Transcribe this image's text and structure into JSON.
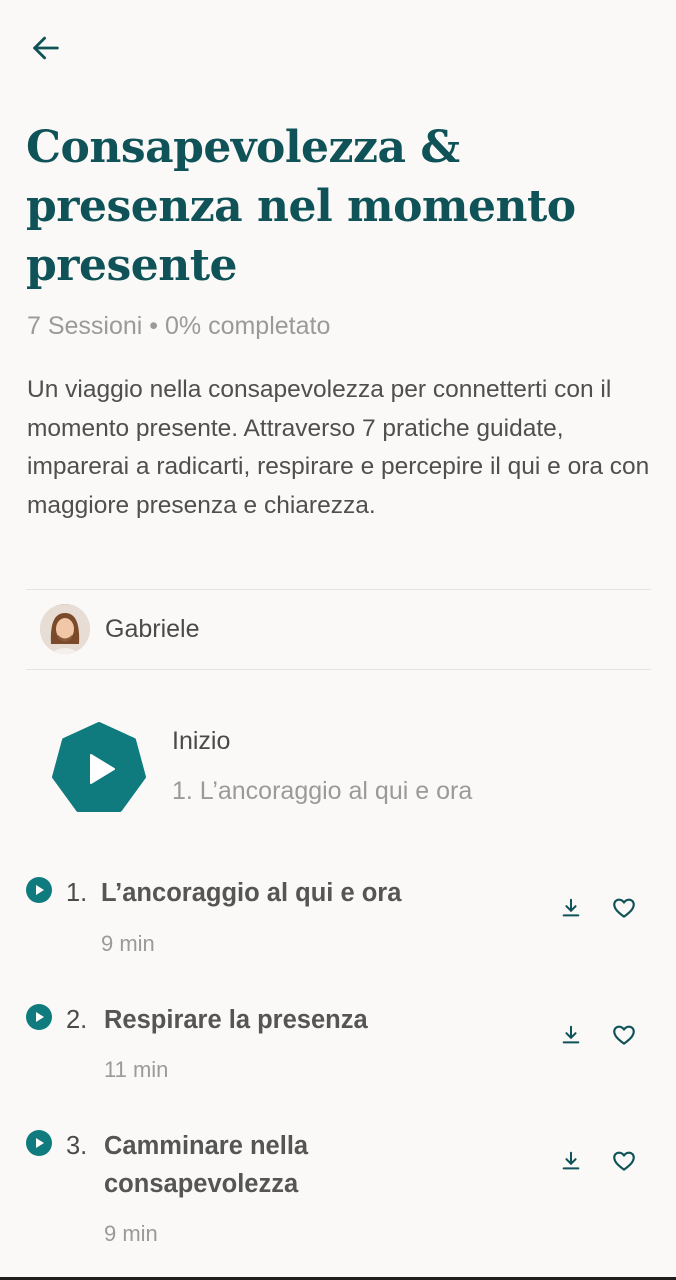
{
  "header": {
    "back_icon": "arrow-left-icon"
  },
  "program": {
    "title": "Consapevolezza & presenza nel momento presente",
    "meta": "7 Sessioni • 0% completato",
    "description": "Un viaggio nella consapevolezza per connetterti con il momento presente. Attraverso 7 pratiche guidate, imparerai a radicarti, respirare e percepire il qui e ora con maggiore presenza e chiarezza."
  },
  "author": {
    "name": "Gabriele"
  },
  "start": {
    "label": "Inizio",
    "session": "1. L’ancoraggio al qui e ora"
  },
  "sessions": [
    {
      "number": "1.",
      "title": "L’ancoraggio al qui e ora",
      "duration": "9 min"
    },
    {
      "number": "2.",
      "title": "Respirare la presenza",
      "duration": "11 min"
    },
    {
      "number": "3.",
      "title": "Camminare nella consapevolezza",
      "duration": "9 min"
    }
  ],
  "colors": {
    "accent": "#0f7b7f",
    "title": "#0f5257",
    "background": "#faf9f7"
  }
}
